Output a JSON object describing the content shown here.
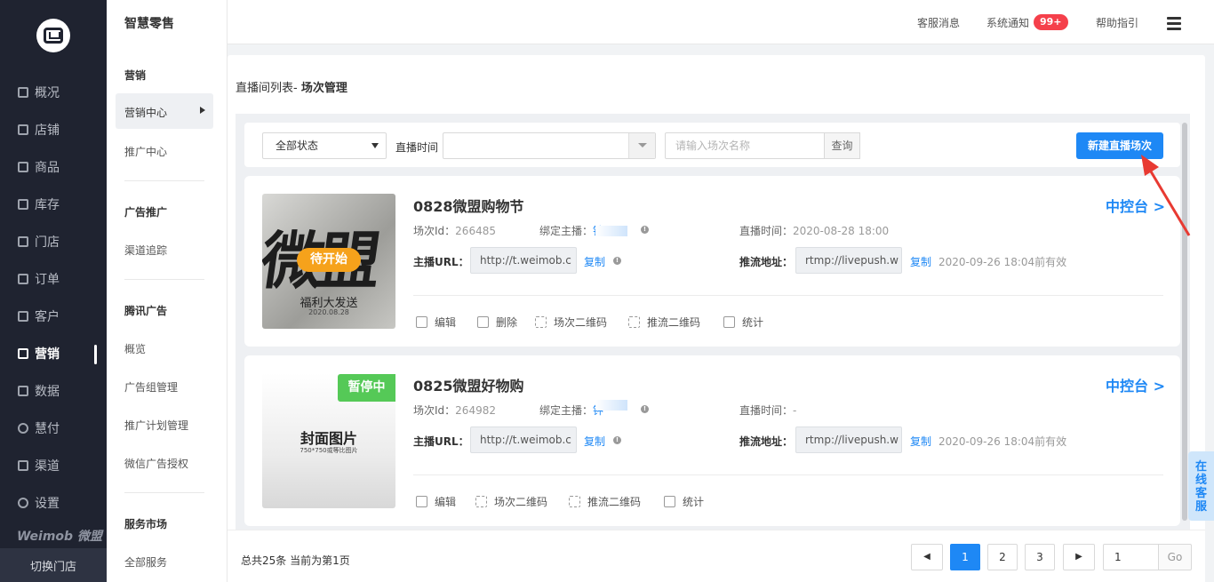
{
  "sidebar": {
    "items": [
      {
        "label": "概况",
        "icon": "list-icon"
      },
      {
        "label": "店铺",
        "icon": "store-icon"
      },
      {
        "label": "商品",
        "icon": "goods-icon"
      },
      {
        "label": "库存",
        "icon": "inventory-icon"
      },
      {
        "label": "门店",
        "icon": "shop-icon"
      },
      {
        "label": "订单",
        "icon": "order-icon"
      },
      {
        "label": "客户",
        "icon": "customer-icon"
      },
      {
        "label": "营销",
        "icon": "marketing-icon",
        "active": true
      },
      {
        "label": "数据",
        "icon": "data-icon"
      },
      {
        "label": "慧付",
        "icon": "pay-icon"
      },
      {
        "label": "渠道",
        "icon": "channel-icon"
      },
      {
        "label": "设置",
        "icon": "settings-icon"
      }
    ],
    "brand": "Weimob 微盟",
    "switch_store": "切换门店"
  },
  "subnav": {
    "app_title": "智慧零售",
    "groups": [
      {
        "heading": "营销",
        "items": [
          "营销中心",
          "推广中心"
        ]
      },
      {
        "heading": "广告推广",
        "items": [
          "渠道追踪"
        ]
      },
      {
        "heading": "腾讯广告",
        "items": [
          "概览",
          "广告组管理",
          "推广计划管理",
          "微信广告授权"
        ]
      },
      {
        "heading": "服务市场",
        "items": [
          "全部服务"
        ]
      }
    ]
  },
  "topbar": {
    "links": [
      "客服消息",
      "系统通知",
      "帮助指引"
    ],
    "badge": "99+"
  },
  "breadcrumb": {
    "parent": "直播间列表- ",
    "current": "场次管理"
  },
  "filter": {
    "status_select": "全部状态",
    "time_label": "直播时间",
    "search_placeholder": "请输入场次名称",
    "search_button": "查询",
    "new_button": "新建直播场次"
  },
  "labels": {
    "session_id": "场次Id：",
    "anchor": "绑定主播：",
    "live_time": "直播时间：",
    "host_url": "主播URL：",
    "push_addr": "推流地址：",
    "copy": "复制",
    "console": "中控台 >"
  },
  "cards": [
    {
      "title": "0828微盟购物节",
      "status": "待开始",
      "session_id": "266485",
      "anchor": "钟",
      "live_time": "2020-08-28 18:00",
      "host_url": "http://t.weimob.c",
      "push_url": "rtmp://livepush.w",
      "expiry": "2020-09-26 18:04前有效",
      "cover_text": "微盟",
      "cover_sub": "福利大发送",
      "cover_date": "2020.08.28",
      "actions": [
        "编辑",
        "删除",
        "场次二维码",
        "推流二维码",
        "统计"
      ]
    },
    {
      "title": "0825微盟好物购",
      "status": "暂停中",
      "session_id": "264982",
      "anchor": "钟",
      "live_time": "-",
      "host_url": "http://t.weimob.c",
      "push_url": "rtmp://livepush.w",
      "expiry": "2020-09-26 18:04前有效",
      "cover_text": "封面图片",
      "cover_sub": "750*750或等比图片",
      "actions": [
        "编辑",
        "场次二维码",
        "推流二维码",
        "统计"
      ]
    }
  ],
  "pagination": {
    "summary": "总共25条 当前为第1页",
    "pages": [
      "1",
      "2",
      "3"
    ],
    "current": "1",
    "goto_value": "1",
    "go": "Go"
  },
  "service_widget": "在线客服",
  "colors": {
    "accent": "#1e88f5",
    "pending": "#f6a21b",
    "paused": "#55c957",
    "badge": "#f5404b"
  }
}
